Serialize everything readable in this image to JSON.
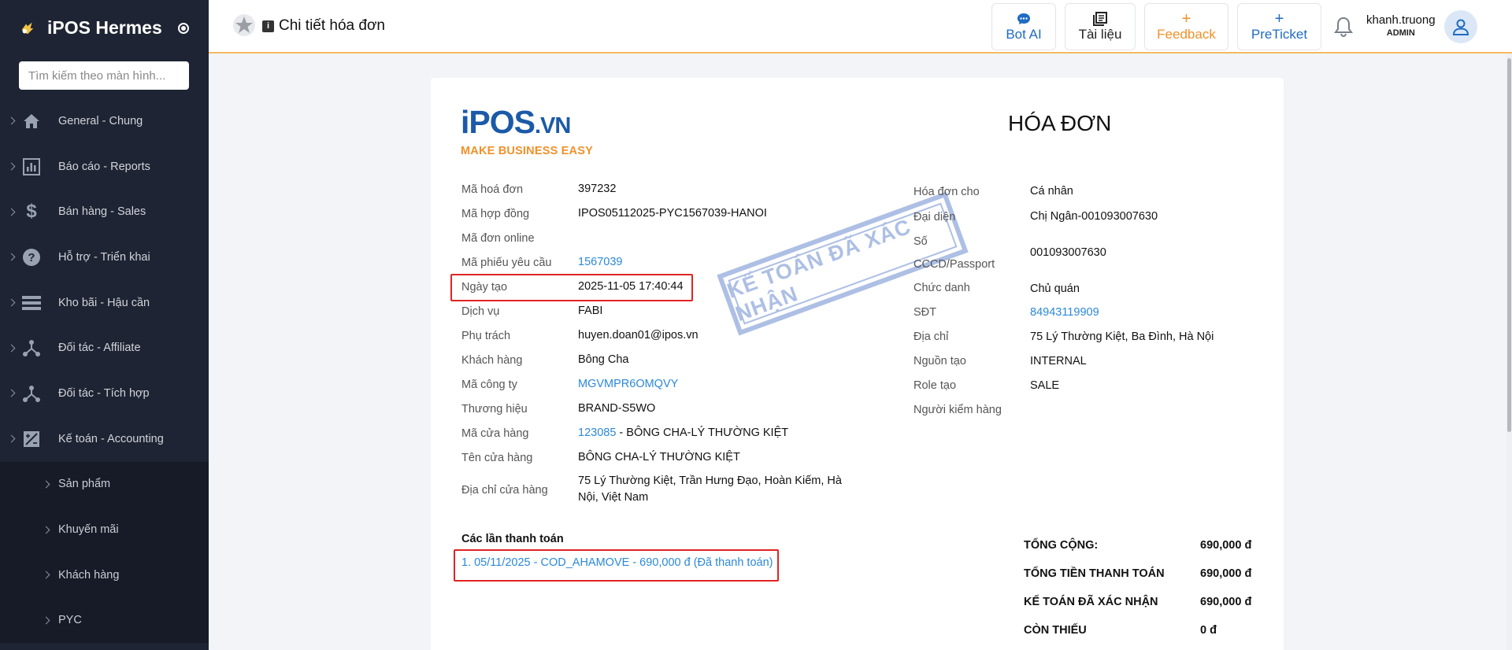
{
  "app": {
    "name": "iPOS Hermes"
  },
  "sidebar": {
    "search_placeholder": "Tìm kiếm theo màn hình...",
    "items": [
      {
        "label": "General - Chung",
        "icon": "home-icon"
      },
      {
        "label": "Báo cáo - Reports",
        "icon": "chart-icon"
      },
      {
        "label": "Bán hàng - Sales",
        "icon": "dollar-icon"
      },
      {
        "label": "Hỗ trợ - Triển khai",
        "icon": "help-icon"
      },
      {
        "label": "Kho bãi - Hậu cần",
        "icon": "storage-icon"
      },
      {
        "label": "Đối tác - Affiliate",
        "icon": "network-icon"
      },
      {
        "label": "Đối tác - Tích hợp",
        "icon": "network-icon"
      },
      {
        "label": "Kế toán - Accounting",
        "icon": "accounting-icon"
      }
    ],
    "subitems": [
      {
        "label": "Sản phẩm"
      },
      {
        "label": "Khuyến mãi"
      },
      {
        "label": "Khách hàng"
      },
      {
        "label": "PYC"
      }
    ]
  },
  "header": {
    "title": "Chi tiết hóa đơn",
    "buttons": {
      "bot": "Bot AI",
      "docs": "Tài liệu",
      "feedback": "Feedback",
      "preticket": "PreTicket"
    },
    "user": {
      "name": "khanh.truong",
      "role": "ADMIN"
    }
  },
  "invoice": {
    "logo": {
      "main": "iPOS",
      "suffix": ".VN",
      "tagline": "MAKE BUSINESS EASY"
    },
    "title": "HÓA ĐƠN",
    "stamp": "KẾ TOÁN ĐÃ XÁC NHẬN",
    "left": [
      {
        "label": "Mã hoá đơn",
        "value": "397232"
      },
      {
        "label": "Mã hợp đồng",
        "value": "IPOS05112025-PYC1567039-HANOI"
      },
      {
        "label": "Mã đơn online",
        "value": ""
      },
      {
        "label": "Mã phiếu yêu cầu",
        "value": "1567039"
      },
      {
        "label": "Ngày tạo",
        "value": "2025-11-05 17:40:44"
      },
      {
        "label": "Dịch vụ",
        "value": "FABI"
      },
      {
        "label": "Phụ trách",
        "value": "huyen.doan01@ipos.vn"
      },
      {
        "label": "Khách hàng",
        "value": "Bông Cha"
      },
      {
        "label": "Mã công ty",
        "value": "MGVMPR6OMQVY"
      },
      {
        "label": "Thương hiệu",
        "value": "BRAND-S5WO"
      },
      {
        "label": "Mã cửa hàng",
        "value_link": "123085",
        "value": " - BÔNG CHA-LÝ THƯỜNG KIỆT"
      },
      {
        "label": "Tên cửa hàng",
        "value": "BÔNG CHA-LÝ THƯỜNG KIỆT"
      },
      {
        "label": "Địa chỉ cửa hàng",
        "value_line1": "75 Lý Thường Kiệt, Trần Hưng Đạo, Hoàn Kiếm, Hà",
        "value_line2": "Nội, Việt Nam"
      }
    ],
    "right": [
      {
        "label": "Hóa đơn cho",
        "value": "Cá nhân"
      },
      {
        "label": "Đại diện",
        "value": "Chị Ngân-001093007630"
      },
      {
        "label_line1": "Số",
        "label_line2": "CCCD/Passport",
        "value": "001093007630"
      },
      {
        "label": "Chức danh",
        "value": "Chủ quán"
      },
      {
        "label": "SĐT",
        "value": "84943119909"
      },
      {
        "label": "Địa chỉ",
        "value": "75 Lý Thường Kiệt, Ba Đình, Hà Nội"
      },
      {
        "label": "Nguồn tạo",
        "value": "INTERNAL"
      },
      {
        "label": "Role tạo",
        "value": "SALE"
      },
      {
        "label": "Người kiểm hàng",
        "value": ""
      }
    ],
    "payments": {
      "title": "Các lần thanh toán",
      "items": [
        "1. 05/11/2025 - COD_AHAMOVE - 690,000 đ (Đã thanh toán)"
      ]
    },
    "totals": [
      {
        "label": "TỔNG CỘNG:",
        "value": "690,000 đ"
      },
      {
        "label": "TỔNG TIỀN THANH TOÁN",
        "value": "690,000 đ"
      },
      {
        "label": "KẾ TOÁN ĐÃ XÁC NHẬN",
        "value": "690,000 đ"
      },
      {
        "label": "CÒN THIẾU",
        "value": "0 đ"
      }
    ]
  },
  "colors": {
    "sidebar_bg": "#1e2433",
    "accent_blue": "#1f6bc4",
    "link": "#2b88d9",
    "feedback_orange": "#f0912a",
    "highlight_red": "#e02424"
  }
}
